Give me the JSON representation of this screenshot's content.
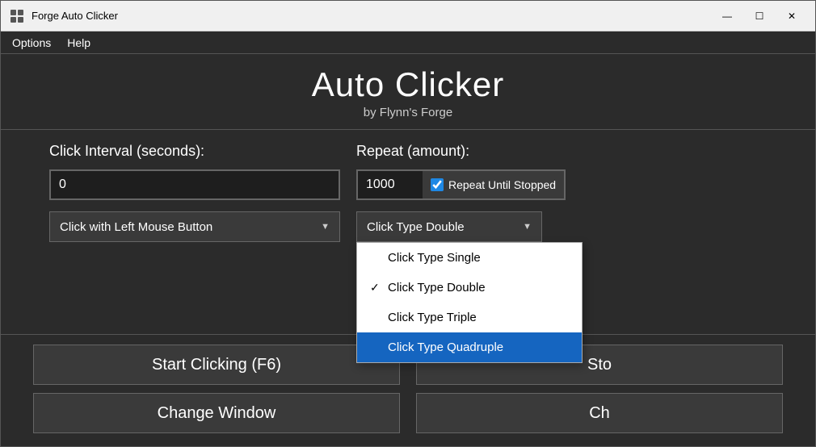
{
  "window": {
    "title": "Forge Auto Clicker",
    "minimize_label": "—",
    "maximize_label": "☐",
    "close_label": "✕"
  },
  "menu": {
    "items": [
      "Options",
      "Help"
    ]
  },
  "header": {
    "app_title": "Auto Clicker",
    "app_subtitle": "by Flynn's Forge"
  },
  "form": {
    "interval_label": "Click Interval (seconds):",
    "repeat_label": "Repeat (amount):",
    "interval_value": "0",
    "repeat_value": "1000",
    "repeat_until_stopped": true,
    "repeat_until_label": "Repeat Until Stopped",
    "mouse_button_label": "Click with Left Mouse Button",
    "click_type_label": "Click Type Double"
  },
  "dropdown_menu": {
    "items": [
      {
        "id": "single",
        "label": "Click Type Single",
        "checked": false,
        "highlighted": false
      },
      {
        "id": "double",
        "label": "Click Type Double",
        "checked": true,
        "highlighted": false
      },
      {
        "id": "triple",
        "label": "Click Type Triple",
        "checked": false,
        "highlighted": false
      },
      {
        "id": "quadruple",
        "label": "Click Type Quadruple",
        "checked": false,
        "highlighted": true
      }
    ]
  },
  "buttons": {
    "start": "Start Clicking (F6)",
    "stop": "Sto",
    "change_window": "Change Window",
    "ch": "Ch"
  }
}
